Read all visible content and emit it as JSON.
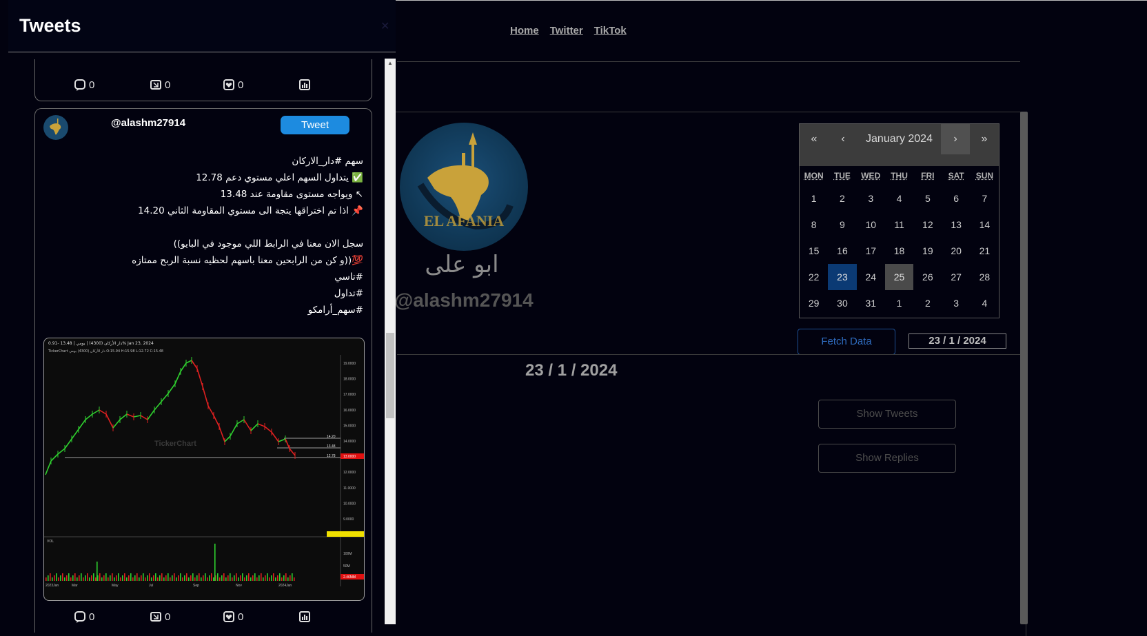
{
  "nav": {
    "links": [
      "Home",
      "Twitter",
      "TikTok"
    ]
  },
  "panel": {
    "title": "Tweets"
  },
  "prev_tweet": {
    "replies": "0",
    "retweets": "0",
    "likes": "0"
  },
  "tweet": {
    "handle": "@alashm27914",
    "button_label": "Tweet",
    "lines": [
      "سهم #دار_الاركان",
      "✅ يتداول السهم اعلي مستوي دعم 12.78",
      "↖ ويواجه مستوى مقاومة عند 13.48",
      "📌 اذا تم اختراقها يتجة الى مستوي المقاومة الثاني 14.20",
      "",
      "سجل الان معنا في الرابط اللي موجود في البايو))",
      "💯((و كن من الرابحين معنا باسهم لحظيه نسبة الربح ممتازه",
      "#تاسي",
      "#تداول",
      "#سهم_أرامكو"
    ],
    "replies": "0",
    "retweets": "0",
    "likes": "0",
    "chart_header": "دار الأركان (4300)  |  يومي  |  13.48  -0.91%  Jan 23, 2024",
    "chart_info": "TickerChart  دار الأركان (4300) يومي  O:15.94  H:15.98  L:12.72  C:15.48",
    "chart_watermark": "TickerChart",
    "chart_levels": [
      "14.20",
      "13.48",
      "12.78"
    ],
    "chart_price_ticks": [
      "19.0000",
      "18.0000",
      "17.0000",
      "16.0000",
      "15.0000",
      "14.0000",
      "13.0000",
      "12.0000",
      "11.0000",
      "10.0000",
      "9.0000"
    ],
    "chart_vol_label": "VOL",
    "chart_vol_ticks": [
      "100M",
      "50M"
    ],
    "chart_x_ticks": [
      "2023Jan",
      "Mar",
      "May",
      "Jul",
      "Sep",
      "Nov",
      "2024Jan"
    ],
    "chart_last_price": "13.0000",
    "chart_vol_last": "2.46MM"
  },
  "profile": {
    "name": "ابو على",
    "handle": "@alashm27914"
  },
  "calendar": {
    "prev_year": "«",
    "prev_month": "‹",
    "month_label": "January 2024",
    "next_month": "›",
    "next_year": "»",
    "weekdays": [
      "MON",
      "TUE",
      "WED",
      "THU",
      "FRI",
      "SAT",
      "SUN"
    ],
    "days": [
      "1",
      "2",
      "3",
      "4",
      "5",
      "6",
      "7",
      "8",
      "9",
      "10",
      "11",
      "12",
      "13",
      "14",
      "15",
      "16",
      "17",
      "18",
      "19",
      "20",
      "21",
      "22",
      "23",
      "24",
      "25",
      "26",
      "27",
      "28",
      "29",
      "30",
      "31",
      "1",
      "2",
      "3",
      "4"
    ],
    "selected_day": "23",
    "today_day": "25"
  },
  "fetch_button": "Fetch Data",
  "date_input_value": "23 / 1 / 2024",
  "selected_date": "23 / 1 / 2024",
  "buttons": {
    "show_tweets": "Show Tweets",
    "show_replies": "Show Replies"
  }
}
